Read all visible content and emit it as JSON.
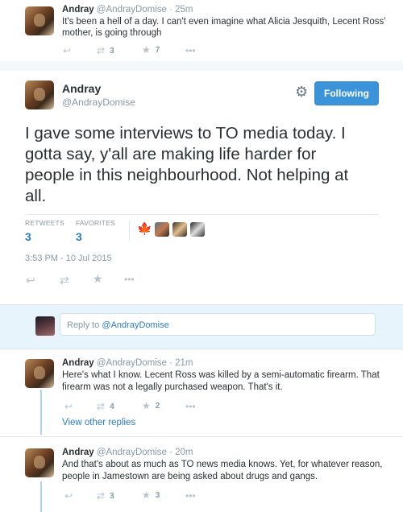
{
  "prev_tweet": {
    "name": "Andray",
    "meta": "@AndrayDomise · 25m",
    "text_1": "It's been a hell of a day. I can't even imagine what Alicia Jesquith, Lecent Ross'",
    "text_2": "mother, is going through",
    "retweets": "3",
    "favorites": "7"
  },
  "main_tweet": {
    "name": "Andray",
    "handle": "@AndrayDomise",
    "follow_label": "Following",
    "text_1": "I gave some interviews to TO media today. I",
    "text_2": "gotta say, y'all are making life harder for",
    "text_3": "people in this neighbourhood. Not helping at",
    "text_4": "all.",
    "retweets_label": "RETWEETS",
    "retweets": "3",
    "favorites_label": "FAVORITES",
    "favorites": "3",
    "timestamp": "3:53 PM - 10 Jul 2015"
  },
  "reply_box": {
    "prompt": "Reply to ",
    "mention": "@AndrayDomise"
  },
  "reply_1": {
    "name": "Andray",
    "meta": "@AndrayDomise · 21m",
    "text_1": "Here's what I know. Lecent Ross was killed by a semi-automatic firearm. That",
    "text_2": "firearm was not a legally purchased weapon. That's it.",
    "retweets": "4",
    "favorites": "2",
    "view_other": "View other replies"
  },
  "reply_2": {
    "name": "Andray",
    "meta": "@AndrayDomise · 20m",
    "text_1": "And that's about as much as TO news media knows. Yet, for whatever reason,",
    "text_2": "people in Jamestown are being asked about drugs and gangs.",
    "retweets": "3",
    "favorites": "3"
  },
  "colors": {
    "link": "#2b7bb9",
    "follow_button": "#3b94d9",
    "separator": "#e1e8ed",
    "thread_line": "#b0d3ee"
  }
}
